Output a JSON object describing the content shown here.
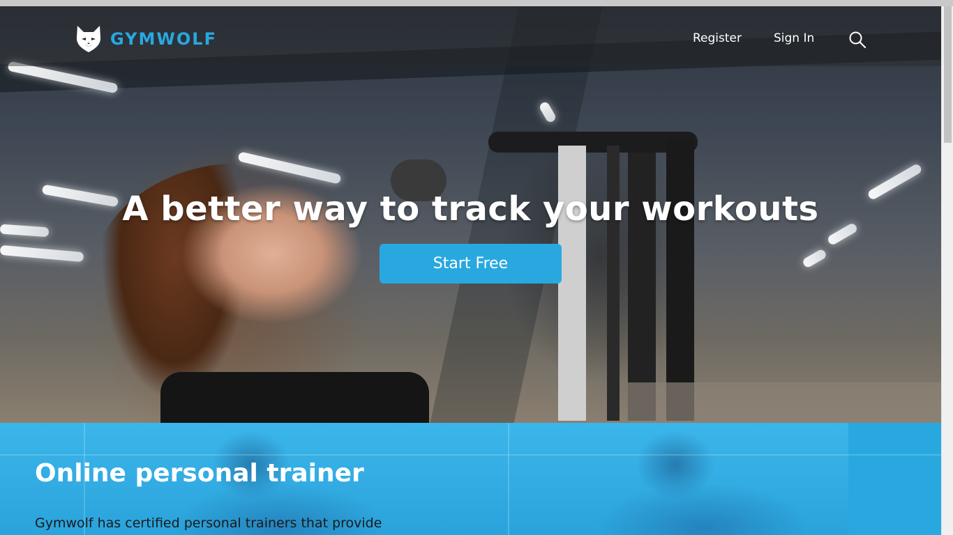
{
  "brand": {
    "name": "GYMWOLF",
    "accent": "#29a8e0"
  },
  "nav": {
    "register_label": "Register",
    "signin_label": "Sign In",
    "search_icon": "search-icon"
  },
  "hero": {
    "headline": "A better way to track your workouts",
    "cta_label": "Start Free"
  },
  "section": {
    "title": "Online personal trainer",
    "body": "Gymwolf has certified personal trainers that provide"
  }
}
